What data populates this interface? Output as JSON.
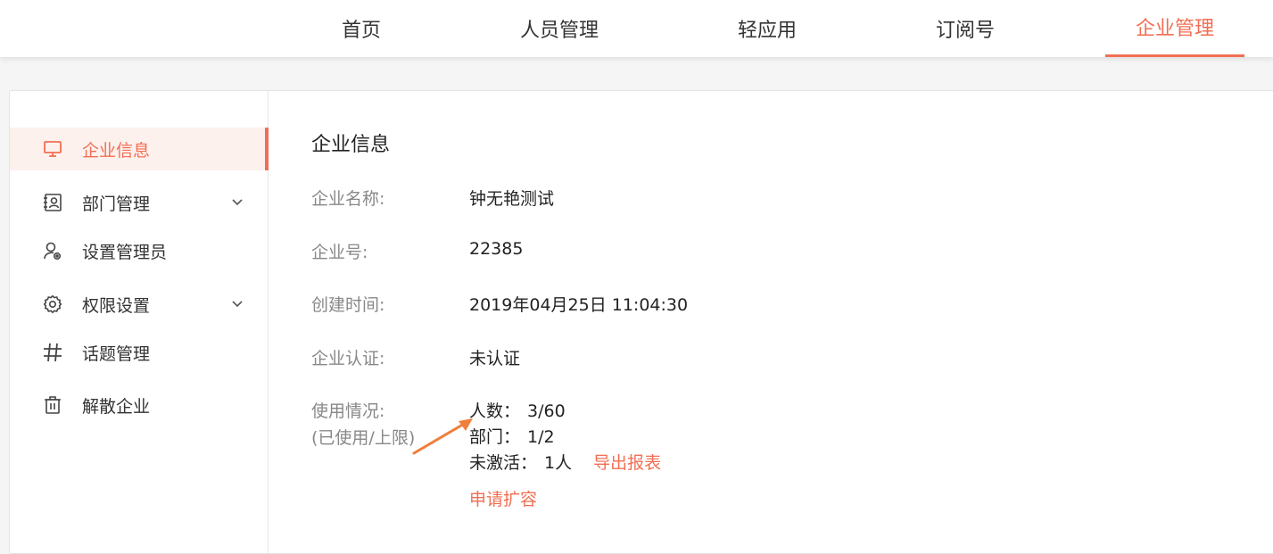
{
  "colors": {
    "accent": "#f26e53",
    "active_bg": "#fdf1ed",
    "label_gray": "#888888"
  },
  "topnav": {
    "tabs": [
      {
        "label": "首页",
        "active": false
      },
      {
        "label": "人员管理",
        "active": false
      },
      {
        "label": "轻应用",
        "active": false
      },
      {
        "label": "订阅号",
        "active": false
      },
      {
        "label": "企业管理",
        "active": true
      }
    ]
  },
  "sidebar": {
    "items": [
      {
        "label": "企业信息",
        "icon": "monitor-icon",
        "active": true,
        "expandable": false
      },
      {
        "label": "部门管理",
        "icon": "contact-card-icon",
        "active": false,
        "expandable": true
      },
      {
        "label": "设置管理员",
        "icon": "admin-user-icon",
        "active": false,
        "expandable": false
      },
      {
        "label": "权限设置",
        "icon": "gear-icon",
        "active": false,
        "expandable": true
      },
      {
        "label": "话题管理",
        "icon": "hashtag-icon",
        "active": false,
        "expandable": false
      },
      {
        "label": "解散企业",
        "icon": "trash-icon",
        "active": false,
        "expandable": false
      }
    ]
  },
  "main": {
    "title": "企业信息",
    "fields": {
      "name_label": "企业名称:",
      "name_value": "钟无艳测试",
      "number_label": "企业号:",
      "number_value": "22385",
      "created_label": "创建时间:",
      "created_value": "2019年04月25日 11:04:30",
      "cert_label": "企业认证:",
      "cert_value": "未认证",
      "usage_label": "使用情况:",
      "usage_sub_label": "(已使用/上限)"
    },
    "usage": {
      "people_label": "人数：",
      "people_value": "3/60",
      "dept_label": "部门：",
      "dept_value": "1/2",
      "inactive_label": "未激活：",
      "inactive_value": "1人",
      "export_link": "导出报表",
      "expand_link": "申请扩容"
    }
  }
}
